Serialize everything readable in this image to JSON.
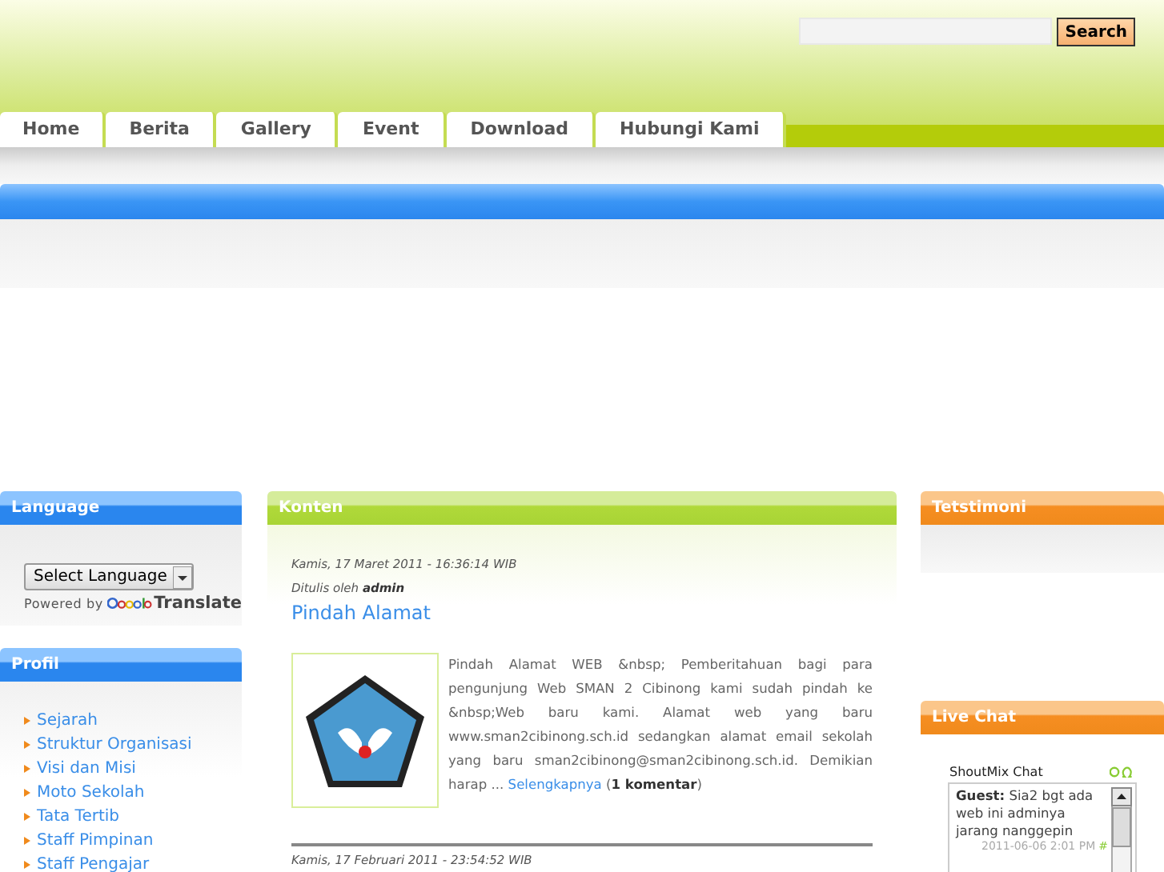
{
  "search": {
    "button": "Search"
  },
  "nav": [
    {
      "label": "Home"
    },
    {
      "label": "Berita"
    },
    {
      "label": "Gallery"
    },
    {
      "label": "Event"
    },
    {
      "label": "Download"
    },
    {
      "label": "Hubungi Kami"
    }
  ],
  "left": {
    "language": {
      "title": "Language",
      "select": "Select Language",
      "powered": "Powered by",
      "translate": "Translate"
    },
    "profil": {
      "title": "Profil",
      "items": [
        "Sejarah",
        "Struktur Organisasi",
        "Visi dan Misi",
        "Moto Sekolah",
        "Tata Tertib",
        "Staff Pimpinan",
        "Staff Pengajar"
      ]
    }
  },
  "content": {
    "title": "Konten",
    "posts": [
      {
        "date": "Kamis, 17 Maret 2011 - 16:36:14 WIB",
        "author_label": "Ditulis oleh",
        "author": "admin",
        "headline": "Pindah Alamat",
        "body": "Pindah Alamat WEB &nbsp; Pemberitahuan bagi para pengunjung Web SMAN 2 Cibinong kami sudah pindah ke &nbsp;Web baru kami. Alamat web yang baru www.sman2cibinong.sch.id sedangkan alamat email sekolah yang baru sman2cibinong@sman2cibinong.sch.id. Demikian harap ...",
        "more": "Selengkapnya",
        "comments": "(**1 komentar**)"
      },
      {
        "date": "Kamis, 17 Februari 2011 - 23:54:52 WIB"
      }
    ]
  },
  "right": {
    "testimoni": {
      "title": "Tetstimoni"
    },
    "chat": {
      "title": "Live Chat",
      "widget": "ShoutMix Chat",
      "messages": [
        {
          "user": "Guest:",
          "text": "Sia2 bgt ada web ini adminya jarang nanggepin",
          "time": "2011-06-06 2:01 PM",
          "mark": "#"
        }
      ]
    }
  }
}
